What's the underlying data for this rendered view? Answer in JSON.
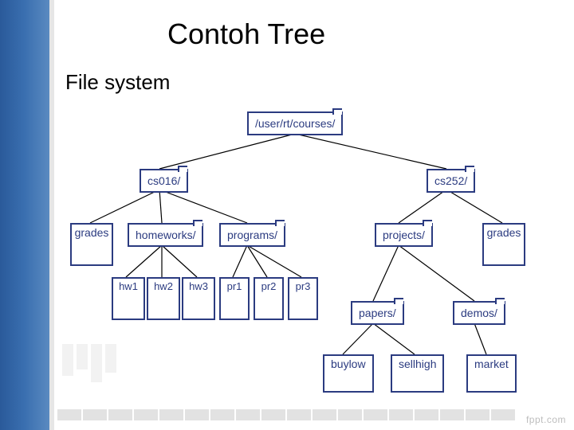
{
  "slide": {
    "title": "Contoh Tree",
    "subtitle": "File system",
    "watermark": "fppt.com"
  },
  "tree": {
    "root": "/user/rt/courses/",
    "cs016": {
      "label": "cs016/",
      "grades": "grades",
      "homeworks": {
        "label": "homeworks/",
        "hw1": "hw1",
        "hw2": "hw2",
        "hw3": "hw3"
      },
      "programs": {
        "label": "programs/",
        "pr1": "pr1",
        "pr2": "pr2",
        "pr3": "pr3"
      }
    },
    "cs252": {
      "label": "cs252/",
      "projects": {
        "label": "projects/",
        "papers": {
          "label": "papers/",
          "buylow": "buylow",
          "sellhigh": "sellhigh"
        },
        "demos": {
          "label": "demos/",
          "market": "market"
        }
      },
      "grades": "grades"
    }
  }
}
